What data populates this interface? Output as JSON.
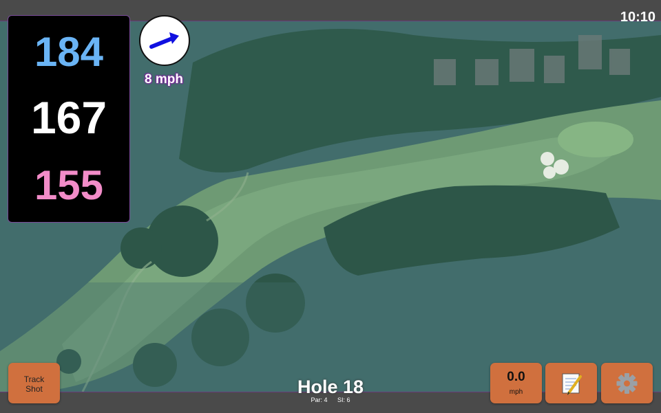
{
  "status": {
    "time": "10:10"
  },
  "distances": {
    "back": "184",
    "middle": "167",
    "front": "155"
  },
  "wind": {
    "speed": "8 mph",
    "icon": "wind-arrow-icon",
    "arrow_color": "#1010e0"
  },
  "hole": {
    "title": "Hole 18",
    "par": "Par: 4",
    "stroke_index": "SI: 6"
  },
  "buttons": {
    "track_shot": {
      "line1": "Track",
      "line2": "Shot"
    },
    "speed": {
      "value": "0.0",
      "unit": "mph"
    },
    "notes": {
      "icon": "notepad-icon"
    },
    "settings": {
      "icon": "gear-icon"
    }
  },
  "colors": {
    "back": "#6ab4f5",
    "middle": "#ffffff",
    "front": "#f28cc8",
    "button": "#d0703e",
    "bar": "#4a4a4a",
    "accent": "#7a4a9a"
  }
}
